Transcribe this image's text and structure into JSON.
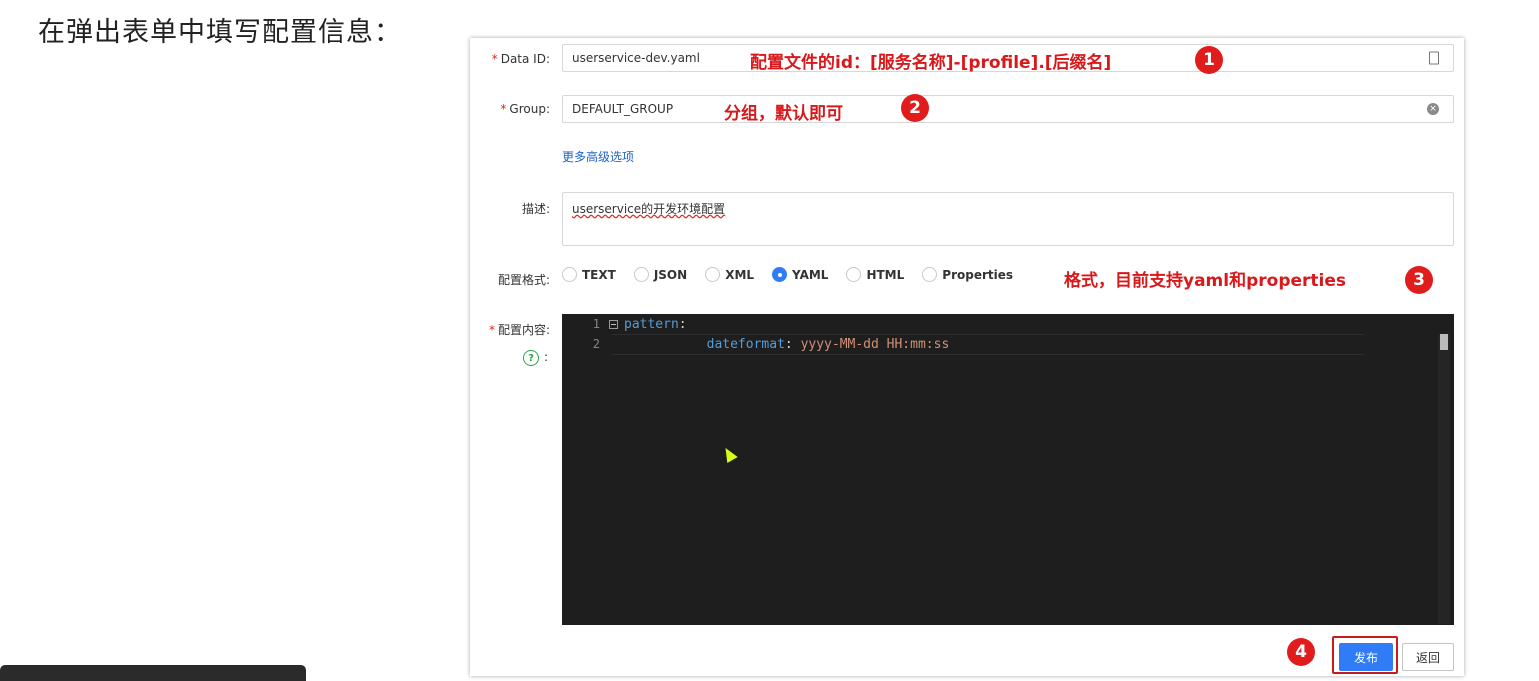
{
  "heading": "在弹出表单中填写配置信息：",
  "form": {
    "data_id": {
      "label": "Data ID:",
      "value": "userservice-dev.yaml"
    },
    "group": {
      "label": "Group:",
      "value": "DEFAULT_GROUP"
    },
    "advanced_link": "更多高级选项",
    "description": {
      "label": "描述:",
      "value": "userservice的开发环境配置"
    },
    "format": {
      "label": "配置格式:",
      "options": [
        "TEXT",
        "JSON",
        "XML",
        "YAML",
        "HTML",
        "Properties"
      ],
      "selected": "YAML"
    },
    "content": {
      "label": "配置内容:",
      "colon": ":",
      "help_icon_glyph": "?",
      "lines": [
        {
          "num": "1",
          "key": "pattern",
          "sep": ":",
          "value": ""
        },
        {
          "num": "2",
          "key": "dateformat",
          "sep": ": ",
          "value": "yyyy-MM-dd HH:mm:ss"
        }
      ]
    },
    "publish_button": "发布",
    "back_button": "返回"
  },
  "annotations": {
    "a1": "配置文件的id：[服务名称]-[profile].[后缀名]",
    "a2": "分组，默认即可",
    "a3": "格式，目前支持yaml和properties"
  },
  "badges": [
    "1",
    "2",
    "3",
    "4"
  ],
  "colors": {
    "accent": "#2f7cf6",
    "annotation_red": "#d8191b",
    "badge_red": "#e01c1c",
    "editor_bg": "#1e1e1e"
  }
}
